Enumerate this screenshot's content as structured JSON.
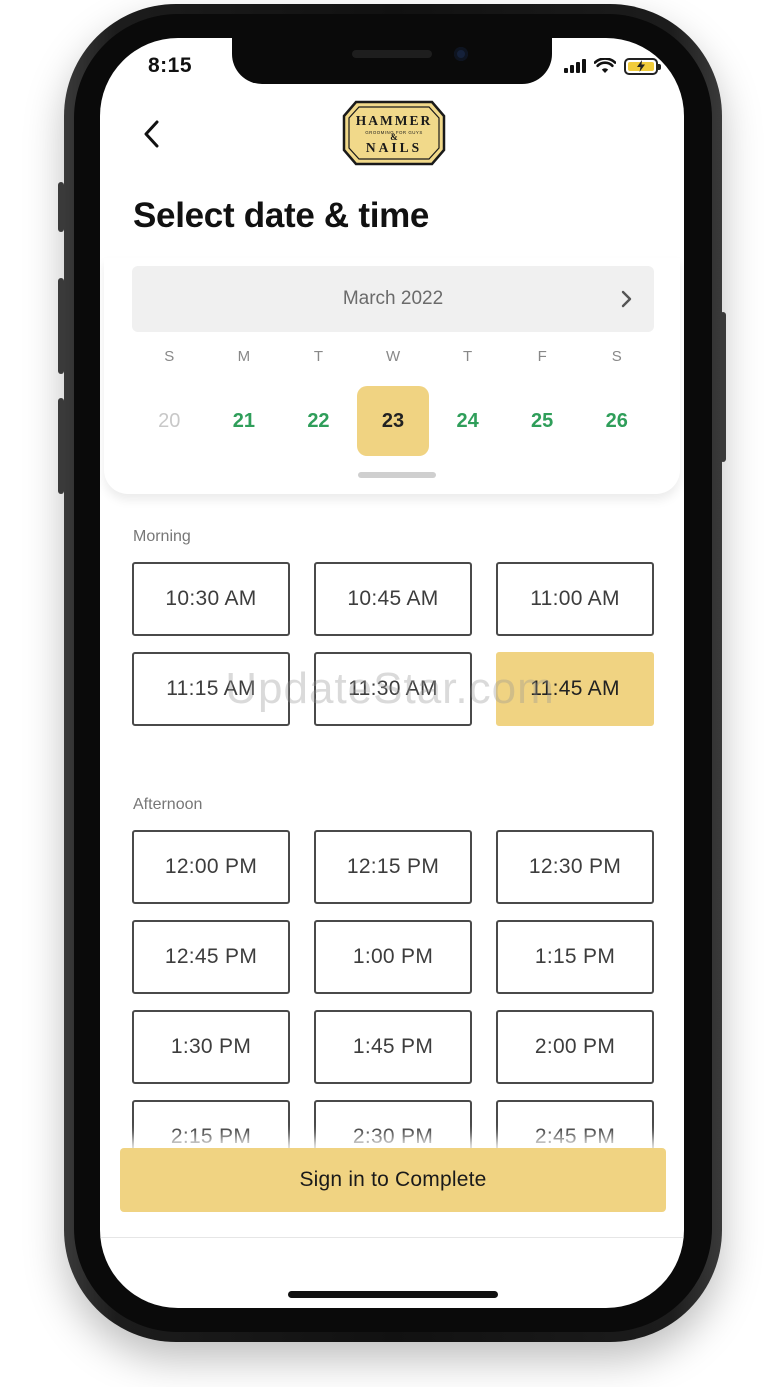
{
  "status_bar": {
    "time": "8:15"
  },
  "header": {
    "logo": {
      "line1": "HAMMER",
      "tagline": "GROOMING FOR GUYS",
      "ampersand": "&",
      "line2": "NAILS"
    },
    "title": "Select date & time"
  },
  "calendar": {
    "month_label": "March 2022",
    "weekdays": [
      "S",
      "M",
      "T",
      "W",
      "T",
      "F",
      "S"
    ],
    "days": [
      {
        "label": "20",
        "state": "disabled"
      },
      {
        "label": "21",
        "state": "available"
      },
      {
        "label": "22",
        "state": "available"
      },
      {
        "label": "23",
        "state": "selected"
      },
      {
        "label": "24",
        "state": "available"
      },
      {
        "label": "25",
        "state": "available"
      },
      {
        "label": "26",
        "state": "available"
      }
    ]
  },
  "morning": {
    "label": "Morning",
    "slots": [
      "10:30 AM",
      "10:45 AM",
      "11:00 AM",
      "11:15 AM",
      "11:30 AM",
      "11:45 AM"
    ],
    "selected_index": 5
  },
  "afternoon": {
    "label": "Afternoon",
    "slots": [
      "12:00 PM",
      "12:15 PM",
      "12:30 PM",
      "12:45 PM",
      "1:00 PM",
      "1:15 PM",
      "1:30 PM",
      "1:45 PM",
      "2:00 PM",
      "2:15 PM",
      "2:30 PM",
      "2:45 PM"
    ]
  },
  "cta": {
    "label": "Sign in to Complete"
  },
  "watermark": "UpdateStar.com",
  "colors": {
    "accent": "#f0d382",
    "available_day": "#2f9e5a",
    "disabled_day": "#c8c8c8",
    "text_dark": "#111111",
    "logo_gold": "#f1d98a"
  },
  "icons": {
    "back": "chevron-left-icon",
    "next_month": "chevron-right-icon",
    "signal": "cellular-signal-icon",
    "wifi": "wifi-icon",
    "battery": "battery-charging-icon"
  }
}
